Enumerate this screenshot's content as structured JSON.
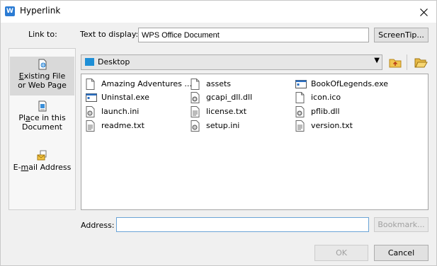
{
  "window": {
    "title": "Hyperlink",
    "app_icon": "W"
  },
  "link_to_label": "Link to:",
  "text_to_display": {
    "label": "Text to display:",
    "value": "WPS Office Document"
  },
  "screentip_button": "ScreenTip...",
  "sidebar": {
    "items": [
      {
        "line1_pre": "",
        "line1_u": "E",
        "line1_post": "xisting File",
        "line2": "or Web Page",
        "icon": "existing-file-icon"
      },
      {
        "line1_pre": "Pl",
        "line1_u": "a",
        "line1_post": "ce in this",
        "line2": "Document",
        "icon": "place-in-document-icon"
      },
      {
        "line1_pre": "E-",
        "line1_u": "m",
        "line1_post": "ail Address",
        "line2": "",
        "icon": "email-icon"
      }
    ]
  },
  "location": {
    "value": "Desktop"
  },
  "files": [
    {
      "name": "Amazing Adventures ...",
      "icon": "document-icon"
    },
    {
      "name": "assets",
      "icon": "document-icon"
    },
    {
      "name": "BookOfLegends.exe",
      "icon": "exe-icon"
    },
    {
      "name": "Uninstal.exe",
      "icon": "exe-icon"
    },
    {
      "name": "gcapi_dll.dll",
      "icon": "dll-icon"
    },
    {
      "name": "icon.ico",
      "icon": "document-icon"
    },
    {
      "name": "launch.ini",
      "icon": "ini-icon"
    },
    {
      "name": "license.txt",
      "icon": "text-file-icon"
    },
    {
      "name": "pflib.dll",
      "icon": "dll-icon"
    },
    {
      "name": "readme.txt",
      "icon": "text-file-icon"
    },
    {
      "name": "setup.ini",
      "icon": "ini-icon"
    },
    {
      "name": "version.txt",
      "icon": "text-file-icon"
    }
  ],
  "address": {
    "label": "Address:",
    "value": ""
  },
  "bookmark_button": "Bookmark...",
  "ok_button": "OK",
  "cancel_button": "Cancel"
}
